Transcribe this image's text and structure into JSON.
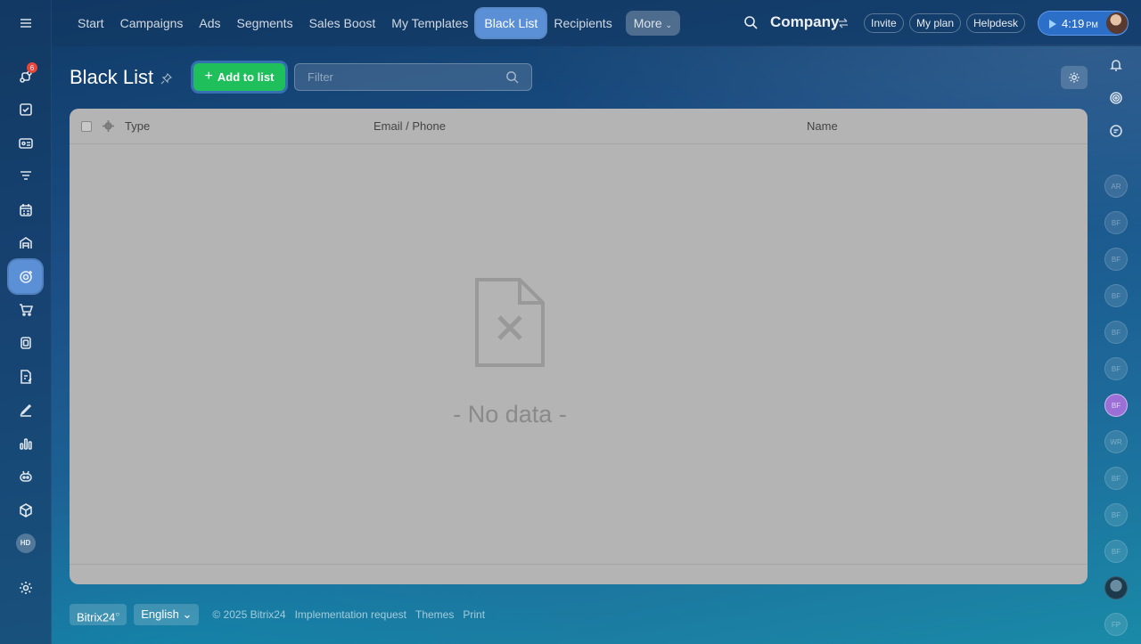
{
  "nav": {
    "items": [
      "Start",
      "Campaigns",
      "Ads",
      "Segments",
      "Sales Boost",
      "My Templates",
      "Black List",
      "Recipients"
    ],
    "active": "Black List",
    "more_label": "More"
  },
  "header": {
    "company": "Company",
    "invite": "Invite",
    "my_plan": "My plan",
    "helpdesk": "Helpdesk",
    "time": "4:19",
    "time_suffix": "PM"
  },
  "sidebar": {
    "notification_count": "6",
    "hd_label": "HD"
  },
  "page": {
    "title": "Black List",
    "add_button": "Add to list",
    "filter_placeholder": "Filter"
  },
  "grid": {
    "columns": [
      "Type",
      "Email / Phone",
      "Name"
    ],
    "empty_text": "- No data -"
  },
  "rail": {
    "avatars": [
      "AR",
      "BF",
      "BF",
      "BF",
      "BF",
      "BF",
      "BF",
      "WR",
      "BF",
      "BF",
      "BF",
      "FP"
    ]
  },
  "footer": {
    "brand": "Bitrix24",
    "language": "English",
    "copyright": "© 2025 Bitrix24",
    "links": [
      "Implementation request",
      "Themes",
      "Print"
    ]
  },
  "colors": {
    "accent": "#5b8fd6",
    "add_button": "#1fbf5c",
    "badge": "#e8453c"
  }
}
